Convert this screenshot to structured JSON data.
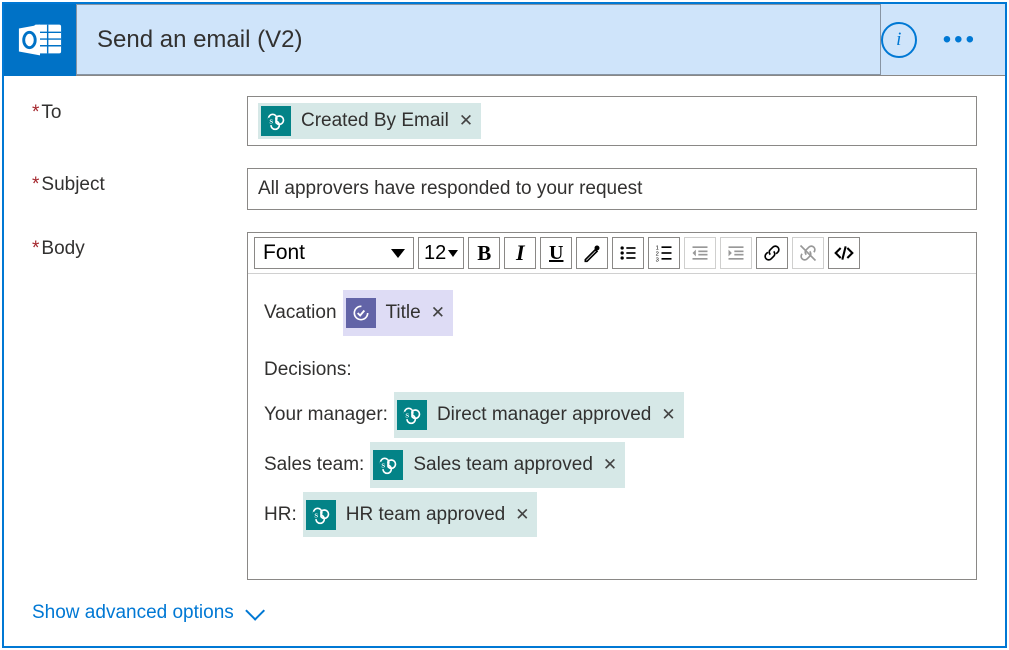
{
  "header": {
    "title": "Send an email (V2)"
  },
  "fields": {
    "to_label": "To",
    "subject_label": "Subject",
    "body_label": "Body"
  },
  "to_token": {
    "label": "Created By Email"
  },
  "subject_value": "All approvers have responded to your request",
  "toolbar": {
    "font": "Font",
    "size": "12"
  },
  "body": {
    "vacation_prefix": "Vacation",
    "title_token": "Title",
    "decisions_heading": "Decisions:",
    "manager_prefix": "Your manager:",
    "manager_token": "Direct manager approved",
    "sales_prefix": "Sales team:",
    "sales_token": "Sales team approved",
    "hr_prefix": "HR:",
    "hr_token": "HR team approved"
  },
  "advanced_label": "Show advanced options"
}
